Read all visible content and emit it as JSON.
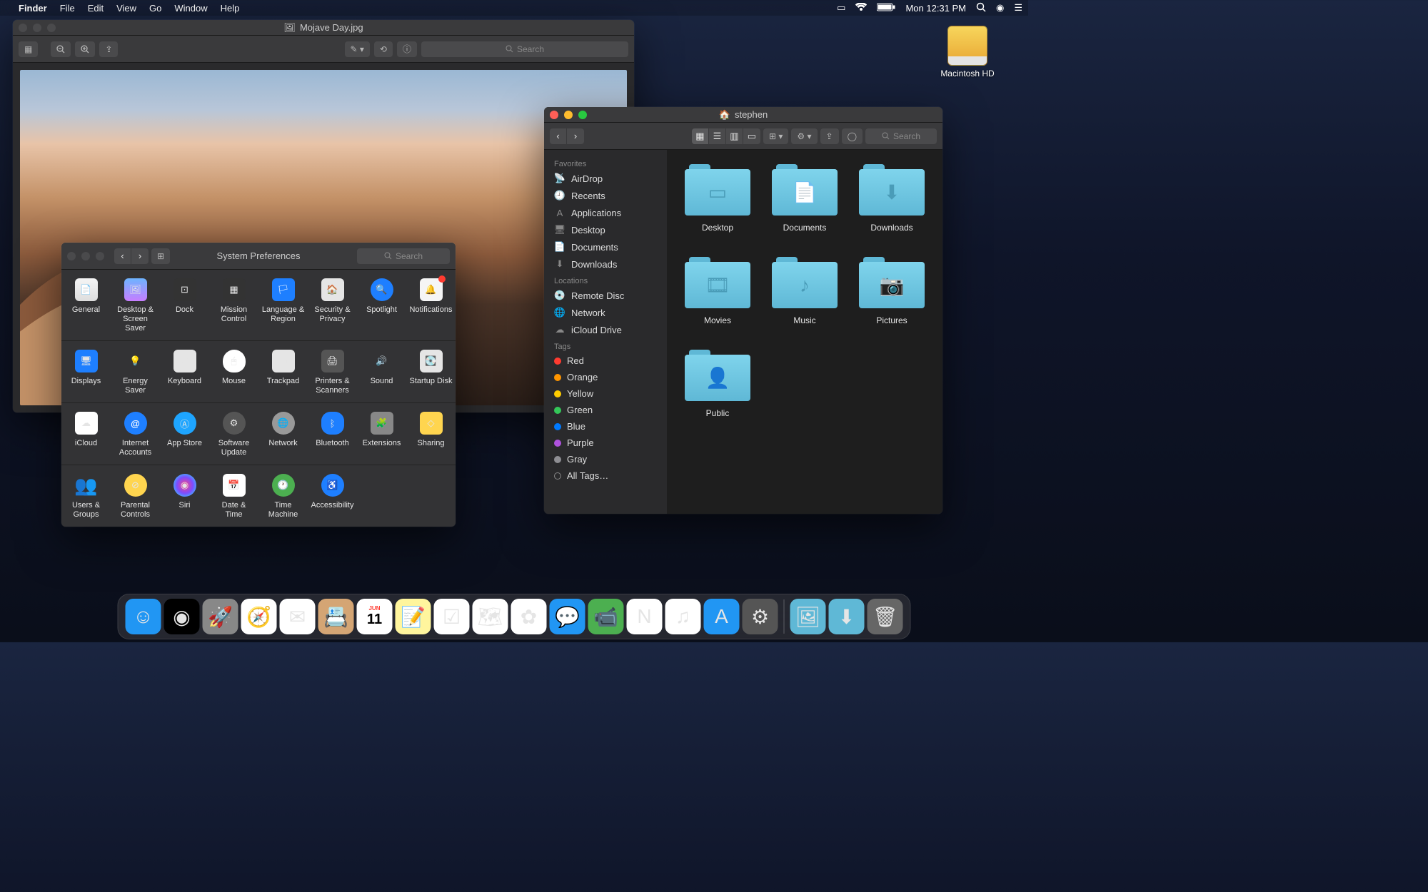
{
  "menubar": {
    "app": "Finder",
    "items": [
      "File",
      "Edit",
      "View",
      "Go",
      "Window",
      "Help"
    ],
    "clock": "Mon 12:31 PM"
  },
  "desktop": {
    "hd": "Macintosh HD"
  },
  "preview": {
    "title": "Mojave Day.jpg",
    "search_ph": "Search"
  },
  "sysprefs": {
    "title": "System Preferences",
    "search_ph": "Search",
    "rows": [
      [
        {
          "k": "general",
          "l": "General"
        },
        {
          "k": "desktop",
          "l": "Desktop & Screen Saver"
        },
        {
          "k": "dock",
          "l": "Dock"
        },
        {
          "k": "mission",
          "l": "Mission Control"
        },
        {
          "k": "lang",
          "l": "Language & Region"
        },
        {
          "k": "security",
          "l": "Security & Privacy"
        },
        {
          "k": "spotlight",
          "l": "Spotlight"
        },
        {
          "k": "notif",
          "l": "Notifications",
          "badge": true
        }
      ],
      [
        {
          "k": "displays",
          "l": "Displays"
        },
        {
          "k": "energy",
          "l": "Energy Saver"
        },
        {
          "k": "keyboard",
          "l": "Keyboard"
        },
        {
          "k": "mouse",
          "l": "Mouse"
        },
        {
          "k": "trackpad",
          "l": "Trackpad"
        },
        {
          "k": "printers",
          "l": "Printers & Scanners"
        },
        {
          "k": "sound",
          "l": "Sound"
        },
        {
          "k": "startup",
          "l": "Startup Disk"
        }
      ],
      [
        {
          "k": "icloud",
          "l": "iCloud"
        },
        {
          "k": "internet",
          "l": "Internet Accounts"
        },
        {
          "k": "appstore",
          "l": "App Store"
        },
        {
          "k": "software",
          "l": "Software Update"
        },
        {
          "k": "network",
          "l": "Network"
        },
        {
          "k": "bluetooth",
          "l": "Bluetooth"
        },
        {
          "k": "ext",
          "l": "Extensions"
        },
        {
          "k": "sharing",
          "l": "Sharing"
        }
      ],
      [
        {
          "k": "users",
          "l": "Users & Groups"
        },
        {
          "k": "parental",
          "l": "Parental Controls"
        },
        {
          "k": "siri",
          "l": "Siri"
        },
        {
          "k": "date",
          "l": "Date & Time"
        },
        {
          "k": "time",
          "l": "Time Machine"
        },
        {
          "k": "a11y",
          "l": "Accessibility"
        }
      ]
    ]
  },
  "finder": {
    "title": "stephen",
    "search_ph": "Search",
    "favorites_h": "Favorites",
    "favorites": [
      {
        "l": "AirDrop",
        "ic": "📡"
      },
      {
        "l": "Recents",
        "ic": "🕘"
      },
      {
        "l": "Applications",
        "ic": "A"
      },
      {
        "l": "Desktop",
        "ic": "🖥"
      },
      {
        "l": "Documents",
        "ic": "📄"
      },
      {
        "l": "Downloads",
        "ic": "⬇"
      }
    ],
    "locations_h": "Locations",
    "locations": [
      {
        "l": "Remote Disc",
        "ic": "💿"
      },
      {
        "l": "Network",
        "ic": "🌐"
      },
      {
        "l": "iCloud Drive",
        "ic": "☁"
      }
    ],
    "tags_h": "Tags",
    "tags": [
      {
        "l": "Red",
        "c": "#ff3b30"
      },
      {
        "l": "Orange",
        "c": "#ff9500"
      },
      {
        "l": "Yellow",
        "c": "#ffcc00"
      },
      {
        "l": "Green",
        "c": "#34c759"
      },
      {
        "l": "Blue",
        "c": "#007aff"
      },
      {
        "l": "Purple",
        "c": "#af52de"
      },
      {
        "l": "Gray",
        "c": "#8e8e93"
      }
    ],
    "all_tags": "All Tags…",
    "folders": [
      {
        "l": "Desktop",
        "s": "▭"
      },
      {
        "l": "Documents",
        "s": "📄"
      },
      {
        "l": "Downloads",
        "s": "⬇"
      },
      {
        "l": "Movies",
        "s": "🎞"
      },
      {
        "l": "Music",
        "s": "♪"
      },
      {
        "l": "Pictures",
        "s": "📷"
      },
      {
        "l": "Public",
        "s": "👤"
      }
    ]
  },
  "dock": [
    {
      "n": "finder",
      "c": "#2196f3",
      "t": "☺"
    },
    {
      "n": "siri",
      "c": "#000",
      "t": "◉"
    },
    {
      "n": "launchpad",
      "c": "#888",
      "t": "🚀"
    },
    {
      "n": "safari",
      "c": "#fff",
      "t": "🧭"
    },
    {
      "n": "mail",
      "c": "#fff",
      "t": "✉"
    },
    {
      "n": "contacts",
      "c": "#d4a574",
      "t": "📇"
    },
    {
      "n": "calendar",
      "c": "#fff",
      "t": "11"
    },
    {
      "n": "notes",
      "c": "#fff59d",
      "t": "📝"
    },
    {
      "n": "reminders",
      "c": "#fff",
      "t": "☑"
    },
    {
      "n": "maps",
      "c": "#fff",
      "t": "🗺"
    },
    {
      "n": "photos",
      "c": "#fff",
      "t": "✿"
    },
    {
      "n": "messages",
      "c": "#2196f3",
      "t": "💬"
    },
    {
      "n": "facetime",
      "c": "#4caf50",
      "t": "📹"
    },
    {
      "n": "news",
      "c": "#fff",
      "t": "N"
    },
    {
      "n": "itunes",
      "c": "#fff",
      "t": "♫"
    },
    {
      "n": "appstore",
      "c": "#2196f3",
      "t": "A"
    },
    {
      "n": "sysprefs",
      "c": "#555",
      "t": "⚙"
    }
  ],
  "dock_right": [
    {
      "n": "desktop-stack",
      "c": "#5fb8d6",
      "t": "🖼"
    },
    {
      "n": "downloads",
      "c": "#5fb8d6",
      "t": "⬇"
    },
    {
      "n": "trash",
      "c": "#666",
      "t": "🗑"
    }
  ]
}
